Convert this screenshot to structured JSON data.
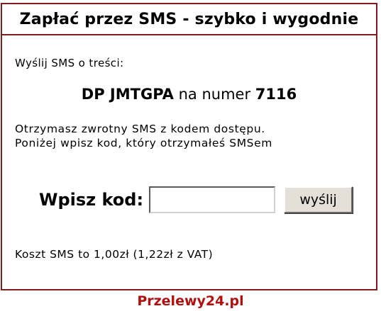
{
  "header": {
    "title": "Zapłać przez SMS - szybko i wygodnie"
  },
  "instruction": "Wyślij SMS o treści:",
  "sms": {
    "content": "DP JMTGPA",
    "connector": "na numer",
    "number": "7116"
  },
  "info": {
    "line1": "Otrzymasz zwrotny SMS z kodem dostępu.",
    "line2": "Poniżej wpisz kod, który otrzymałeś SMSem"
  },
  "form": {
    "label": "Wpisz kod:",
    "input_value": "",
    "button_label": "wyślij"
  },
  "cost": "Koszt SMS to 1,00zł (1,22zł z VAT)",
  "footer": {
    "brand": "Przelewy24.pl"
  },
  "colors": {
    "border": "#7f1d1d",
    "brand": "#b01010"
  }
}
